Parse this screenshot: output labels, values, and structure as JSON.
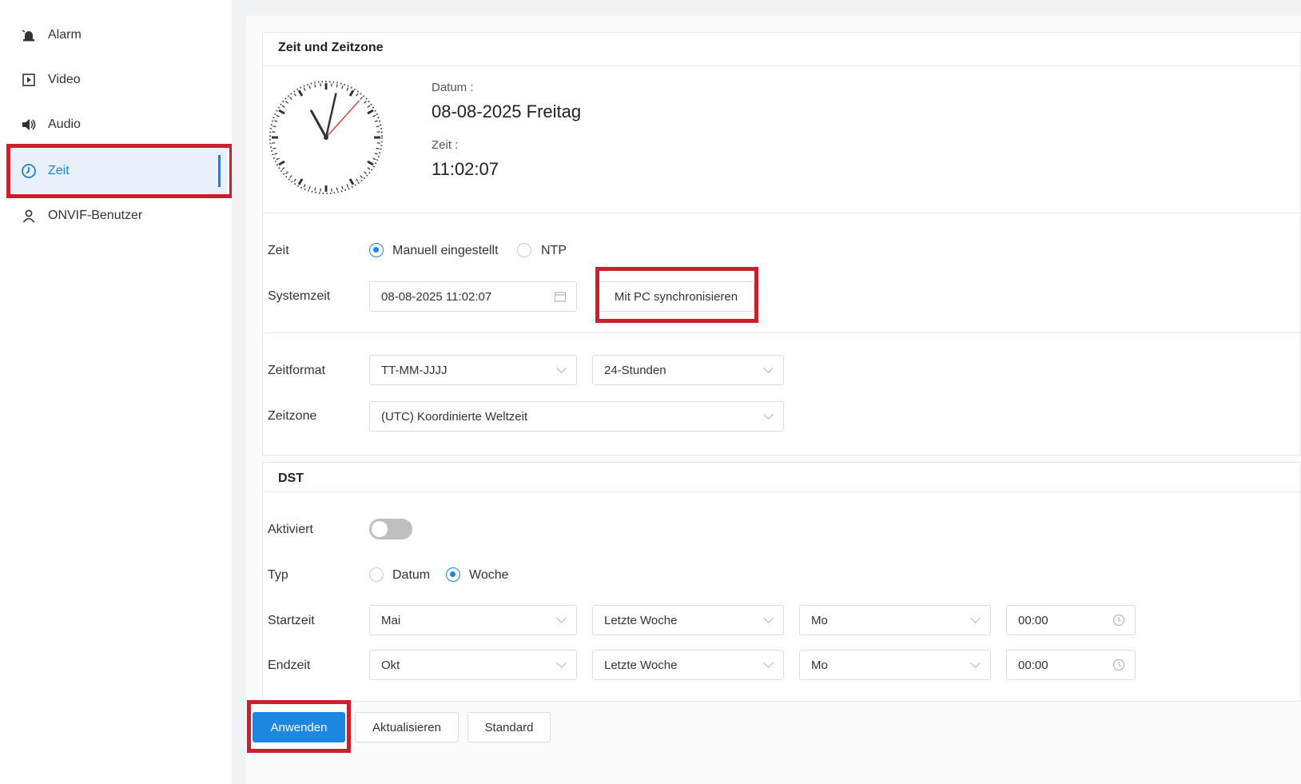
{
  "sidebar": {
    "items": [
      {
        "label": "Alarm",
        "icon": "alarm-icon"
      },
      {
        "label": "Video",
        "icon": "video-icon"
      },
      {
        "label": "Audio",
        "icon": "speaker-icon"
      },
      {
        "label": "Zeit",
        "icon": "clock-icon",
        "active": true
      },
      {
        "label": "ONVIF-Benutzer",
        "icon": "user-icon"
      }
    ]
  },
  "time_section": {
    "title": "Zeit und Zeitzone",
    "date_label": "Datum :",
    "date_value": "08-08-2025 Freitag",
    "time_label": "Zeit :",
    "time_value": "11:02:07",
    "clock": {
      "hour": 11,
      "minute": 2,
      "second": 7
    }
  },
  "settings": {
    "zeit_label": "Zeit",
    "mode_manual": "Manuell eingestellt",
    "mode_ntp": "NTP",
    "mode_selected": "manual",
    "systemzeit_label": "Systemzeit",
    "systemzeit_value": "08-08-2025 11:02:07",
    "sync_button": "Mit PC synchronisieren",
    "zeitformat_label": "Zeitformat",
    "date_format": "TT-MM-JJJJ",
    "hour_format": "24-Stunden",
    "zeitzone_label": "Zeitzone",
    "zeitzone_value": "(UTC) Koordinierte Weltzeit"
  },
  "dst": {
    "title": "DST",
    "aktiviert_label": "Aktiviert",
    "enabled": false,
    "typ_label": "Typ",
    "typ_datum": "Datum",
    "typ_woche": "Woche",
    "typ_selected": "woche",
    "startzeit_label": "Startzeit",
    "start": {
      "month": "Mai",
      "week": "Letzte Woche",
      "day": "Mo",
      "time": "00:00"
    },
    "endzeit_label": "Endzeit",
    "end": {
      "month": "Okt",
      "week": "Letzte Woche",
      "day": "Mo",
      "time": "00:00"
    }
  },
  "actions": {
    "apply": "Anwenden",
    "refresh": "Aktualisieren",
    "default": "Standard"
  },
  "colors": {
    "accent": "#1c86e0",
    "highlight": "#cc1f2c"
  }
}
